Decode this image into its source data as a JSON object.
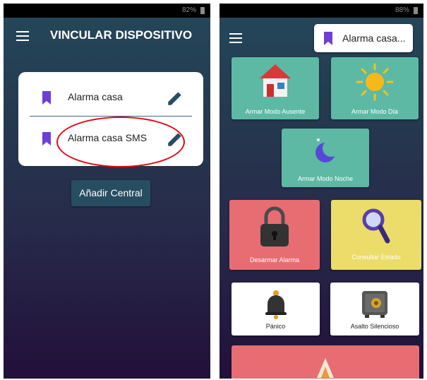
{
  "left_screen": {
    "status_text": "82%",
    "title": "VINCULAR DISPOSITIVO",
    "devices": [
      {
        "label": "Alarma casa"
      },
      {
        "label": "Alarma casa SMS"
      }
    ],
    "add_button": "Añadir Central"
  },
  "right_screen": {
    "status_text": "88%",
    "selected_device": "Alarma casa...",
    "tiles": [
      {
        "label": "Armar Modo Ausente",
        "color": "#5db9a4"
      },
      {
        "label": "Armar Modo Día",
        "color": "#5db9a4"
      },
      {
        "label": "Armar Modo Noche",
        "color": "#5db9a4"
      },
      {
        "label": "Desarmar Alarma",
        "color": "#e86d73"
      },
      {
        "label": "Consultar Estado",
        "color": "#ecdc6a"
      },
      {
        "label": "Pánico",
        "color": "#ffffff"
      },
      {
        "label": "Asalto Silencioso",
        "color": "#ffffff"
      },
      {
        "label": "",
        "color": "#e86d73"
      }
    ]
  },
  "colors": {
    "accent": "#274d63",
    "bookmark": "#6d3fd4",
    "highlight_circle": "#e30613"
  }
}
